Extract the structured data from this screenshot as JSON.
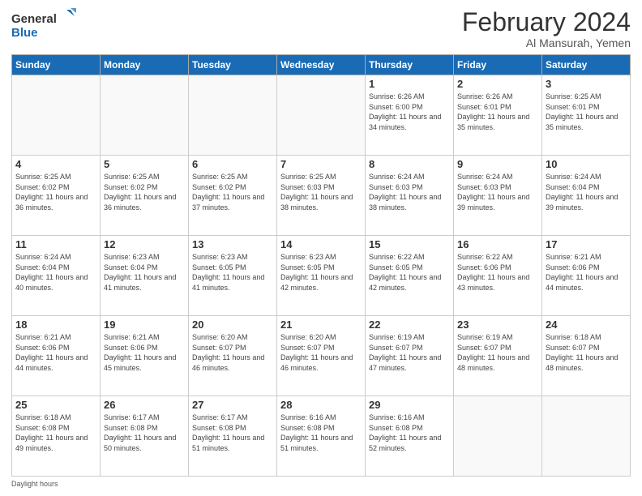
{
  "logo": {
    "line1": "General",
    "line2": "Blue"
  },
  "title": "February 2024",
  "subtitle": "Al Mansurah, Yemen",
  "days_of_week": [
    "Sunday",
    "Monday",
    "Tuesday",
    "Wednesday",
    "Thursday",
    "Friday",
    "Saturday"
  ],
  "weeks": [
    [
      {
        "day": "",
        "info": ""
      },
      {
        "day": "",
        "info": ""
      },
      {
        "day": "",
        "info": ""
      },
      {
        "day": "",
        "info": ""
      },
      {
        "day": "1",
        "info": "Sunrise: 6:26 AM\nSunset: 6:00 PM\nDaylight: 11 hours\nand 34 minutes."
      },
      {
        "day": "2",
        "info": "Sunrise: 6:26 AM\nSunset: 6:01 PM\nDaylight: 11 hours\nand 35 minutes."
      },
      {
        "day": "3",
        "info": "Sunrise: 6:25 AM\nSunset: 6:01 PM\nDaylight: 11 hours\nand 35 minutes."
      }
    ],
    [
      {
        "day": "4",
        "info": "Sunrise: 6:25 AM\nSunset: 6:02 PM\nDaylight: 11 hours\nand 36 minutes."
      },
      {
        "day": "5",
        "info": "Sunrise: 6:25 AM\nSunset: 6:02 PM\nDaylight: 11 hours\nand 36 minutes."
      },
      {
        "day": "6",
        "info": "Sunrise: 6:25 AM\nSunset: 6:02 PM\nDaylight: 11 hours\nand 37 minutes."
      },
      {
        "day": "7",
        "info": "Sunrise: 6:25 AM\nSunset: 6:03 PM\nDaylight: 11 hours\nand 38 minutes."
      },
      {
        "day": "8",
        "info": "Sunrise: 6:24 AM\nSunset: 6:03 PM\nDaylight: 11 hours\nand 38 minutes."
      },
      {
        "day": "9",
        "info": "Sunrise: 6:24 AM\nSunset: 6:03 PM\nDaylight: 11 hours\nand 39 minutes."
      },
      {
        "day": "10",
        "info": "Sunrise: 6:24 AM\nSunset: 6:04 PM\nDaylight: 11 hours\nand 39 minutes."
      }
    ],
    [
      {
        "day": "11",
        "info": "Sunrise: 6:24 AM\nSunset: 6:04 PM\nDaylight: 11 hours\nand 40 minutes."
      },
      {
        "day": "12",
        "info": "Sunrise: 6:23 AM\nSunset: 6:04 PM\nDaylight: 11 hours\nand 41 minutes."
      },
      {
        "day": "13",
        "info": "Sunrise: 6:23 AM\nSunset: 6:05 PM\nDaylight: 11 hours\nand 41 minutes."
      },
      {
        "day": "14",
        "info": "Sunrise: 6:23 AM\nSunset: 6:05 PM\nDaylight: 11 hours\nand 42 minutes."
      },
      {
        "day": "15",
        "info": "Sunrise: 6:22 AM\nSunset: 6:05 PM\nDaylight: 11 hours\nand 42 minutes."
      },
      {
        "day": "16",
        "info": "Sunrise: 6:22 AM\nSunset: 6:06 PM\nDaylight: 11 hours\nand 43 minutes."
      },
      {
        "day": "17",
        "info": "Sunrise: 6:21 AM\nSunset: 6:06 PM\nDaylight: 11 hours\nand 44 minutes."
      }
    ],
    [
      {
        "day": "18",
        "info": "Sunrise: 6:21 AM\nSunset: 6:06 PM\nDaylight: 11 hours\nand 44 minutes."
      },
      {
        "day": "19",
        "info": "Sunrise: 6:21 AM\nSunset: 6:06 PM\nDaylight: 11 hours\nand 45 minutes."
      },
      {
        "day": "20",
        "info": "Sunrise: 6:20 AM\nSunset: 6:07 PM\nDaylight: 11 hours\nand 46 minutes."
      },
      {
        "day": "21",
        "info": "Sunrise: 6:20 AM\nSunset: 6:07 PM\nDaylight: 11 hours\nand 46 minutes."
      },
      {
        "day": "22",
        "info": "Sunrise: 6:19 AM\nSunset: 6:07 PM\nDaylight: 11 hours\nand 47 minutes."
      },
      {
        "day": "23",
        "info": "Sunrise: 6:19 AM\nSunset: 6:07 PM\nDaylight: 11 hours\nand 48 minutes."
      },
      {
        "day": "24",
        "info": "Sunrise: 6:18 AM\nSunset: 6:07 PM\nDaylight: 11 hours\nand 48 minutes."
      }
    ],
    [
      {
        "day": "25",
        "info": "Sunrise: 6:18 AM\nSunset: 6:08 PM\nDaylight: 11 hours\nand 49 minutes."
      },
      {
        "day": "26",
        "info": "Sunrise: 6:17 AM\nSunset: 6:08 PM\nDaylight: 11 hours\nand 50 minutes."
      },
      {
        "day": "27",
        "info": "Sunrise: 6:17 AM\nSunset: 6:08 PM\nDaylight: 11 hours\nand 51 minutes."
      },
      {
        "day": "28",
        "info": "Sunrise: 6:16 AM\nSunset: 6:08 PM\nDaylight: 11 hours\nand 51 minutes."
      },
      {
        "day": "29",
        "info": "Sunrise: 6:16 AM\nSunset: 6:08 PM\nDaylight: 11 hours\nand 52 minutes."
      },
      {
        "day": "",
        "info": ""
      },
      {
        "day": "",
        "info": ""
      }
    ]
  ],
  "footer_label": "Daylight hours"
}
